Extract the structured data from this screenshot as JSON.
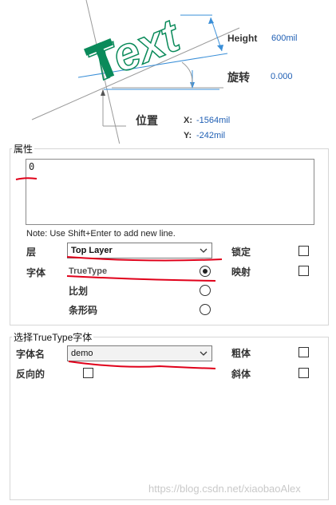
{
  "preview": {
    "logo_text": "Text",
    "height_label": "Height",
    "height_value": "600mil",
    "rotation_label": "旋转",
    "rotation_value": "0.000",
    "position_label": "位置",
    "x_label": "X:",
    "x_value": "-1564mil",
    "y_label": "Y:",
    "y_value": "-242mil",
    "colors": {
      "text_green": "#0a8a5a",
      "value_blue": "#1f5fb4",
      "line_blue": "#3a8fd8"
    }
  },
  "properties": {
    "group_title": "属性",
    "text_value": "0",
    "note": "Note: Use Shift+Enter to add new line.",
    "layer_label": "层",
    "layer_value": "Top Layer",
    "lock_label": "锁定",
    "font_label": "字体",
    "font_options": [
      "TrueType",
      "比划",
      "条形码"
    ],
    "mirror_label": "映射"
  },
  "truetype": {
    "group_title": "选择TrueType字体",
    "font_name_label": "字体名",
    "font_name_value": "demo",
    "bold_label": "粗体",
    "inverted_label": "反向的",
    "italic_label": "斜体"
  },
  "watermark": "https://blog.csdn.net/xiaobaoAlex"
}
